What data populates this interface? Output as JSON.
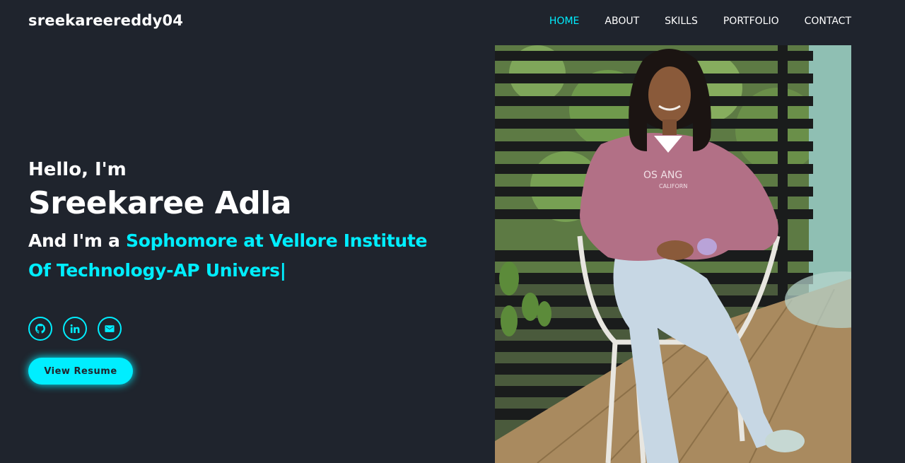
{
  "header": {
    "logo": "sreekareereddy04",
    "nav": [
      "HOME",
      "ABOUT",
      "SKILLS",
      "PORTFOLIO",
      "CONTACT"
    ],
    "active_nav": "HOME"
  },
  "hero": {
    "greeting": "Hello, I'm",
    "name": "Sreekaree Adla",
    "role_prefix": "And I'm a ",
    "role_line1": "Sophomore at Vellore Institute",
    "role_line2": "Of Technology-AP Univers",
    "cursor": "|",
    "resume_button": "View Resume"
  },
  "socials": [
    {
      "icon": "github-icon"
    },
    {
      "icon": "linkedin-icon"
    },
    {
      "icon": "mail-icon"
    }
  ],
  "colors": {
    "background": "#1f242d",
    "accent": "#00eeff",
    "text": "#ffffff"
  }
}
